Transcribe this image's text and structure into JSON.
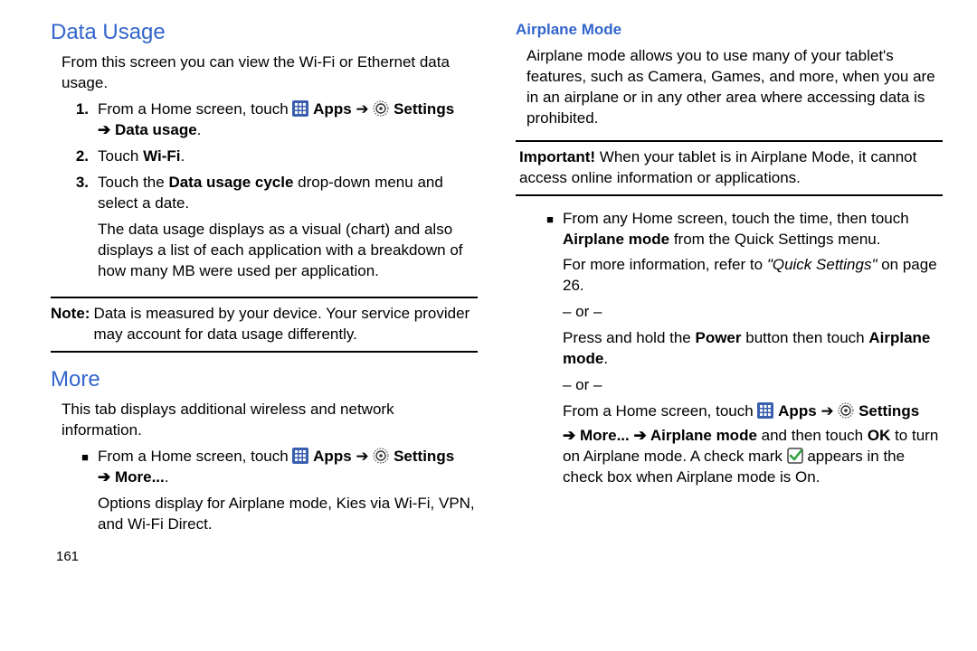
{
  "left": {
    "h_data_usage": "Data Usage",
    "intro": "From this screen you can view the Wi-Fi or Ethernet data usage.",
    "steps": {
      "n1": "1.",
      "s1_pre": "From a Home screen, touch ",
      "s1_apps": "Apps",
      "s1_arrow1": " ➔ ",
      "s1_settings": "Settings",
      "s1_line2_arrow": "➔ ",
      "s1_line2_du": "Data usage",
      "s1_line2_dot": ".",
      "n2": "2.",
      "s2_a": "Touch ",
      "s2_b": "Wi-Fi",
      "s2_c": ".",
      "n3": "3.",
      "s3_a": "Touch the ",
      "s3_b": "Data usage cycle",
      "s3_c": " drop-down menu and select a date.",
      "s3_p2": "The data usage displays as a visual (chart) and also displays a list of each application with a breakdown of how many MB were used per application."
    },
    "note_lbl": "Note: ",
    "note_txt": "Data is measured by your device. Your service provider may account for data usage differently.",
    "h_more": "More",
    "more_intro": "This tab displays additional wireless and network information.",
    "more_bullet": {
      "pre": "From a Home screen, touch ",
      "apps": "Apps",
      "arrow1": " ➔ ",
      "settings": "Settings",
      "line2_arrow": "➔ ",
      "line2_more": "More...",
      "line2_dot": ".",
      "p2": "Options display for Airplane mode, Kies via Wi-Fi, VPN, and Wi-Fi Direct."
    },
    "page": "161"
  },
  "right": {
    "h_airplane": "Airplane Mode",
    "intro": "Airplane mode allows you to use many of your tablet's features, such as Camera, Games, and more, when you are in an airplane or in any other area where accessing data is prohibited.",
    "imp_lbl": "Important! ",
    "imp_txt": "When your tablet is in Airplane Mode, it cannot access online information or applications.",
    "b1_a": "From any Home screen, touch the time, then touch ",
    "b1_b": "Airplane mode",
    "b1_c": " from the Quick Settings menu.",
    "b1_p2a": "For more information, refer to ",
    "b1_p2b": "\"Quick Settings\"",
    "b1_p2c": "  on page 26.",
    "or": "– or –",
    "b2_a": "Press and hold the ",
    "b2_b": "Power",
    "b2_c": " button then touch ",
    "b2_d": "Airplane mode",
    "b2_e": ".",
    "b3_pre": "From a Home screen, touch ",
    "b3_apps": "Apps",
    "b3_arrow1": " ➔ ",
    "b3_settings": "Settings",
    "b3_l2_arrow1": "➔ ",
    "b3_l2_more": "More...",
    "b3_l2_arrow2": " ➔ ",
    "b3_l2_am": "Airplane mode",
    "b3_l2_and": " and then touch ",
    "b3_l2_ok": "OK",
    "b3_l2_tail": " to turn on Airplane mode. A check mark ",
    "b3_l2_tail2": " appears in the check box when Airplane mode is On."
  },
  "icons": {
    "apps": "apps-icon",
    "settings": "settings-icon",
    "check": "check-icon"
  }
}
